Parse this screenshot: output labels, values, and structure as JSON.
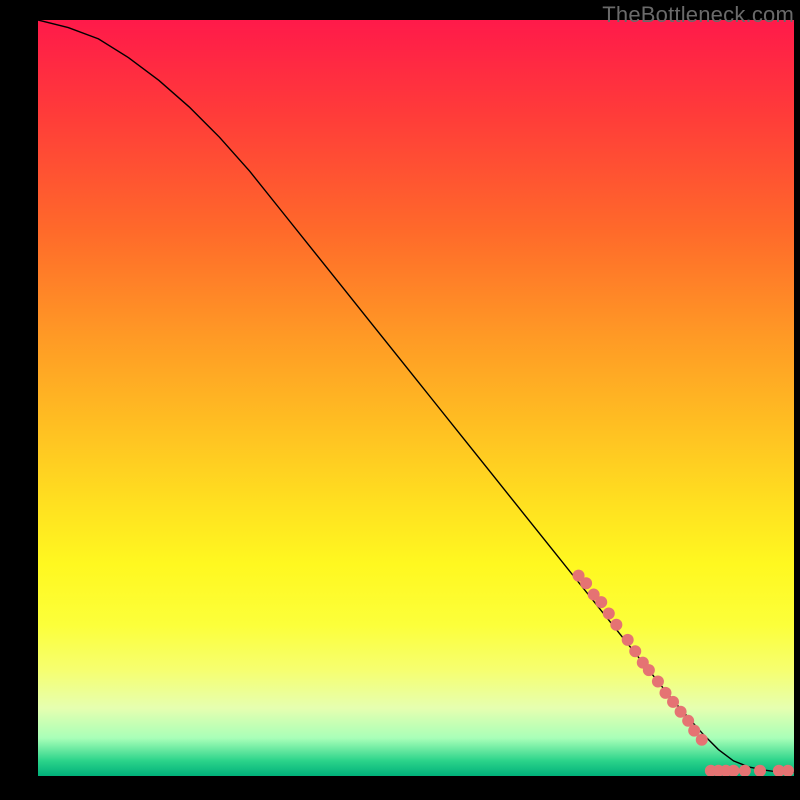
{
  "watermark": "TheBottleneck.com",
  "chart_data": {
    "type": "line",
    "title": "",
    "xlabel": "",
    "ylabel": "",
    "xlim": [
      0,
      100
    ],
    "ylim": [
      0,
      100
    ],
    "grid": false,
    "curve": {
      "name": "curve",
      "color": "#000000",
      "stroke_width": 1.4,
      "x": [
        0,
        4,
        8,
        12,
        16,
        20,
        24,
        28,
        32,
        36,
        40,
        44,
        48,
        52,
        56,
        60,
        64,
        68,
        72,
        76,
        80,
        84,
        88,
        90,
        92,
        94,
        96,
        98,
        100
      ],
      "y": [
        100,
        99,
        97.5,
        95,
        92,
        88.5,
        84.5,
        80,
        75,
        70,
        65,
        60,
        55,
        50,
        45,
        40,
        35,
        30,
        25,
        20,
        15,
        10,
        5.5,
        3.5,
        2,
        1.2,
        0.8,
        0.5,
        0.5
      ]
    },
    "scatter_series": [
      {
        "name": "cluster-diagonal",
        "color": "#e57373",
        "radius": 6,
        "points": [
          {
            "x": 71.5,
            "y": 26.5
          },
          {
            "x": 72.5,
            "y": 25.5
          },
          {
            "x": 73.5,
            "y": 24.0
          },
          {
            "x": 74.5,
            "y": 23.0
          },
          {
            "x": 75.5,
            "y": 21.5
          },
          {
            "x": 76.5,
            "y": 20.0
          },
          {
            "x": 78.0,
            "y": 18.0
          },
          {
            "x": 79.0,
            "y": 16.5
          },
          {
            "x": 80.0,
            "y": 15.0
          },
          {
            "x": 80.8,
            "y": 14.0
          },
          {
            "x": 82.0,
            "y": 12.5
          },
          {
            "x": 83.0,
            "y": 11.0
          },
          {
            "x": 84.0,
            "y": 9.8
          },
          {
            "x": 85.0,
            "y": 8.5
          },
          {
            "x": 86.0,
            "y": 7.3
          },
          {
            "x": 86.8,
            "y": 6.0
          },
          {
            "x": 87.8,
            "y": 4.8
          }
        ]
      },
      {
        "name": "cluster-bottom",
        "color": "#e57373",
        "radius": 6,
        "points": [
          {
            "x": 89.0,
            "y": 0.7
          },
          {
            "x": 90.0,
            "y": 0.7
          },
          {
            "x": 91.0,
            "y": 0.7
          },
          {
            "x": 92.0,
            "y": 0.7
          },
          {
            "x": 93.5,
            "y": 0.7
          },
          {
            "x": 95.5,
            "y": 0.7
          },
          {
            "x": 98.0,
            "y": 0.7
          },
          {
            "x": 99.2,
            "y": 0.7
          }
        ]
      }
    ]
  }
}
